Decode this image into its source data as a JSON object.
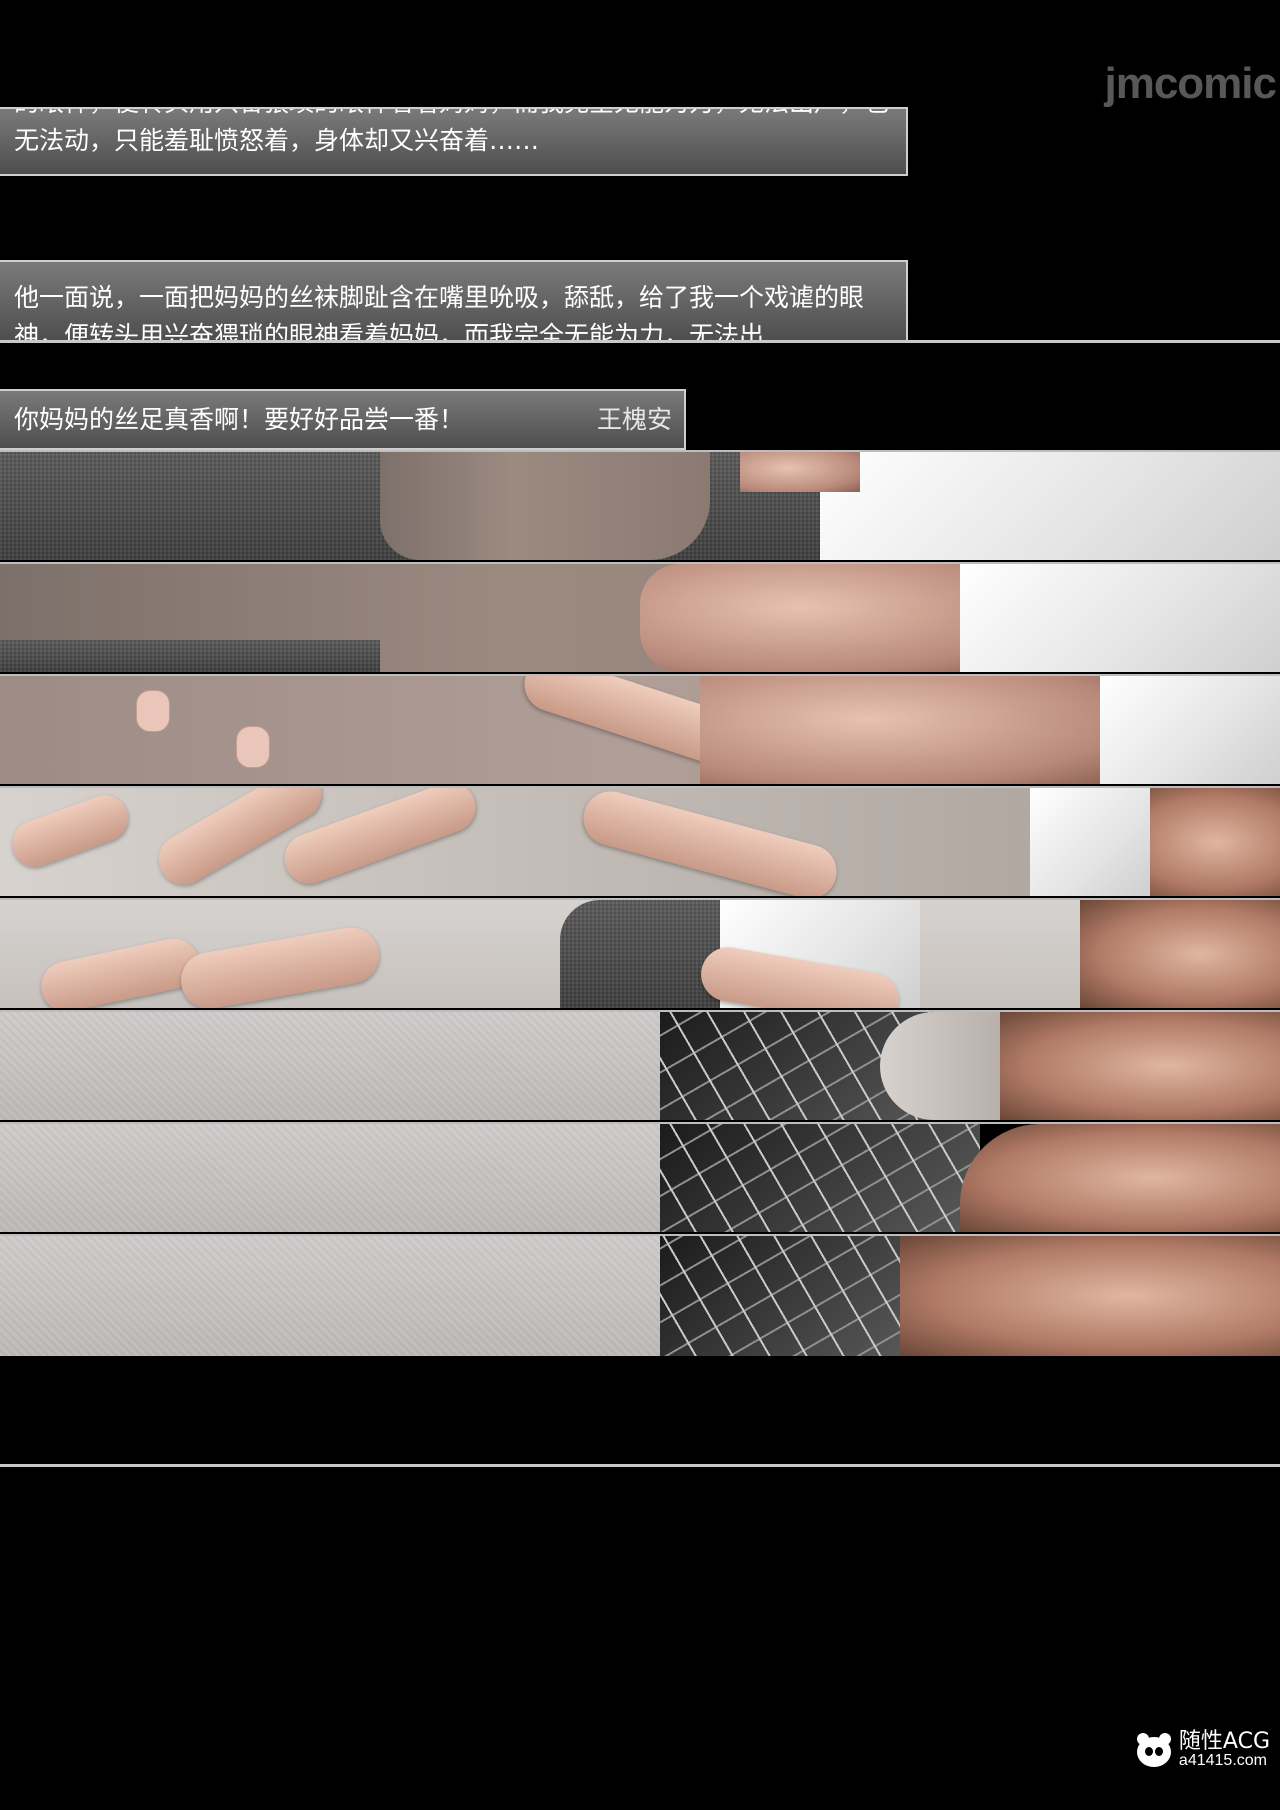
{
  "watermark_top": "jmcomic",
  "caption_1": "的眼神，便转头用兴奋猥琐的眼神看着妈妈，而我完全无能为力，无法出声，也无法动，只能羞耻愤怒着，身体却又兴奋着……",
  "caption_2": "他一面说，一面把妈妈的丝袜脚趾含在嘴里吮吸，舔舐，给了我一个戏谑的眼神，便转头用兴奋猥琐的眼神看着妈妈，而我完全无能为力，无法出",
  "dialogue": {
    "text": "你妈妈的丝足真香啊！要好好品尝一番！",
    "speaker": "王槐安"
  },
  "watermark_bottom": {
    "name": "随性ACG",
    "url": "a41415.com"
  },
  "colors": {
    "background": "#000000",
    "textbox_top": "#7a7a7a",
    "textbox_bottom": "#4e4e4e",
    "textbox_border": "#cfcfcf"
  }
}
